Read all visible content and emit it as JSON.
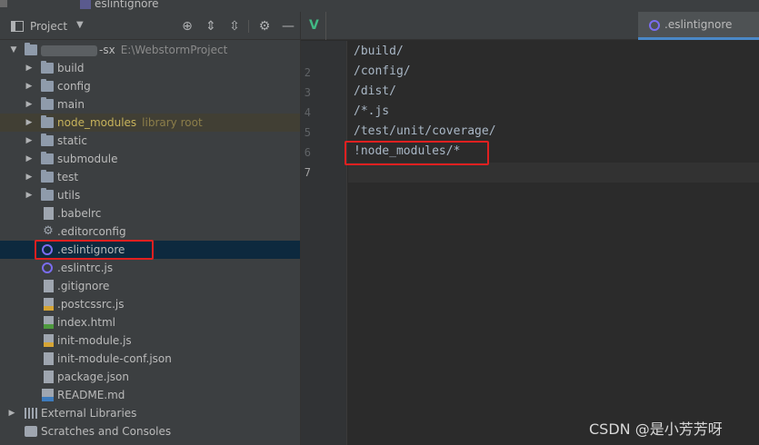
{
  "titlebar": {
    "file_name": "eslintignore"
  },
  "project_panel": {
    "title": "Project",
    "dropdown_glyph": "▼",
    "buttons": [
      {
        "name": "locate-icon",
        "glyph": "⊕"
      },
      {
        "name": "expand-all-icon",
        "glyph": "⇕"
      },
      {
        "name": "collapse-all-icon",
        "glyph": "⇳"
      },
      {
        "name": "gear-icon",
        "glyph": "⚙"
      },
      {
        "name": "hide-icon",
        "glyph": "—"
      }
    ],
    "root": {
      "name_suffix": "-sx",
      "path": "E:\\WebstormProject"
    },
    "folders": [
      {
        "label": "build"
      },
      {
        "label": "config"
      },
      {
        "label": "main"
      },
      {
        "label": "node_modules",
        "hint": "library root"
      },
      {
        "label": "static"
      },
      {
        "label": "submodule"
      },
      {
        "label": "test"
      },
      {
        "label": "utils"
      }
    ],
    "files": [
      {
        "label": ".babelrc"
      },
      {
        "label": ".editorconfig"
      },
      {
        "label": ".eslintignore"
      },
      {
        "label": ".eslintrc.js"
      },
      {
        "label": ".gitignore"
      },
      {
        "label": ".postcssrc.js"
      },
      {
        "label": "index.html"
      },
      {
        "label": "init-module.js"
      },
      {
        "label": "init-module-conf.json"
      },
      {
        "label": "package.json"
      },
      {
        "label": "README.md"
      }
    ],
    "external_libraries": "External Libraries",
    "scratches": "Scratches and Consoles"
  },
  "editor": {
    "first_tab_icon": "V",
    "active_tab": ".eslintignore",
    "line_numbers": [
      "2",
      "3",
      "4",
      "5",
      "6",
      "7"
    ],
    "lines": [
      "/build/",
      "/config/",
      "/dist/",
      "/*.js",
      "/test/unit/coverage/",
      "!node_modules/*",
      ""
    ]
  },
  "watermark": "CSDN @是小芳芳呀",
  "colors": {
    "panel_bg": "#3c3f41",
    "editor_bg": "#2b2b2b",
    "selection": "#0d293e",
    "library_row": "#413f34",
    "highlight_box": "#e02020",
    "eslint_icon": "#7a6df0"
  }
}
